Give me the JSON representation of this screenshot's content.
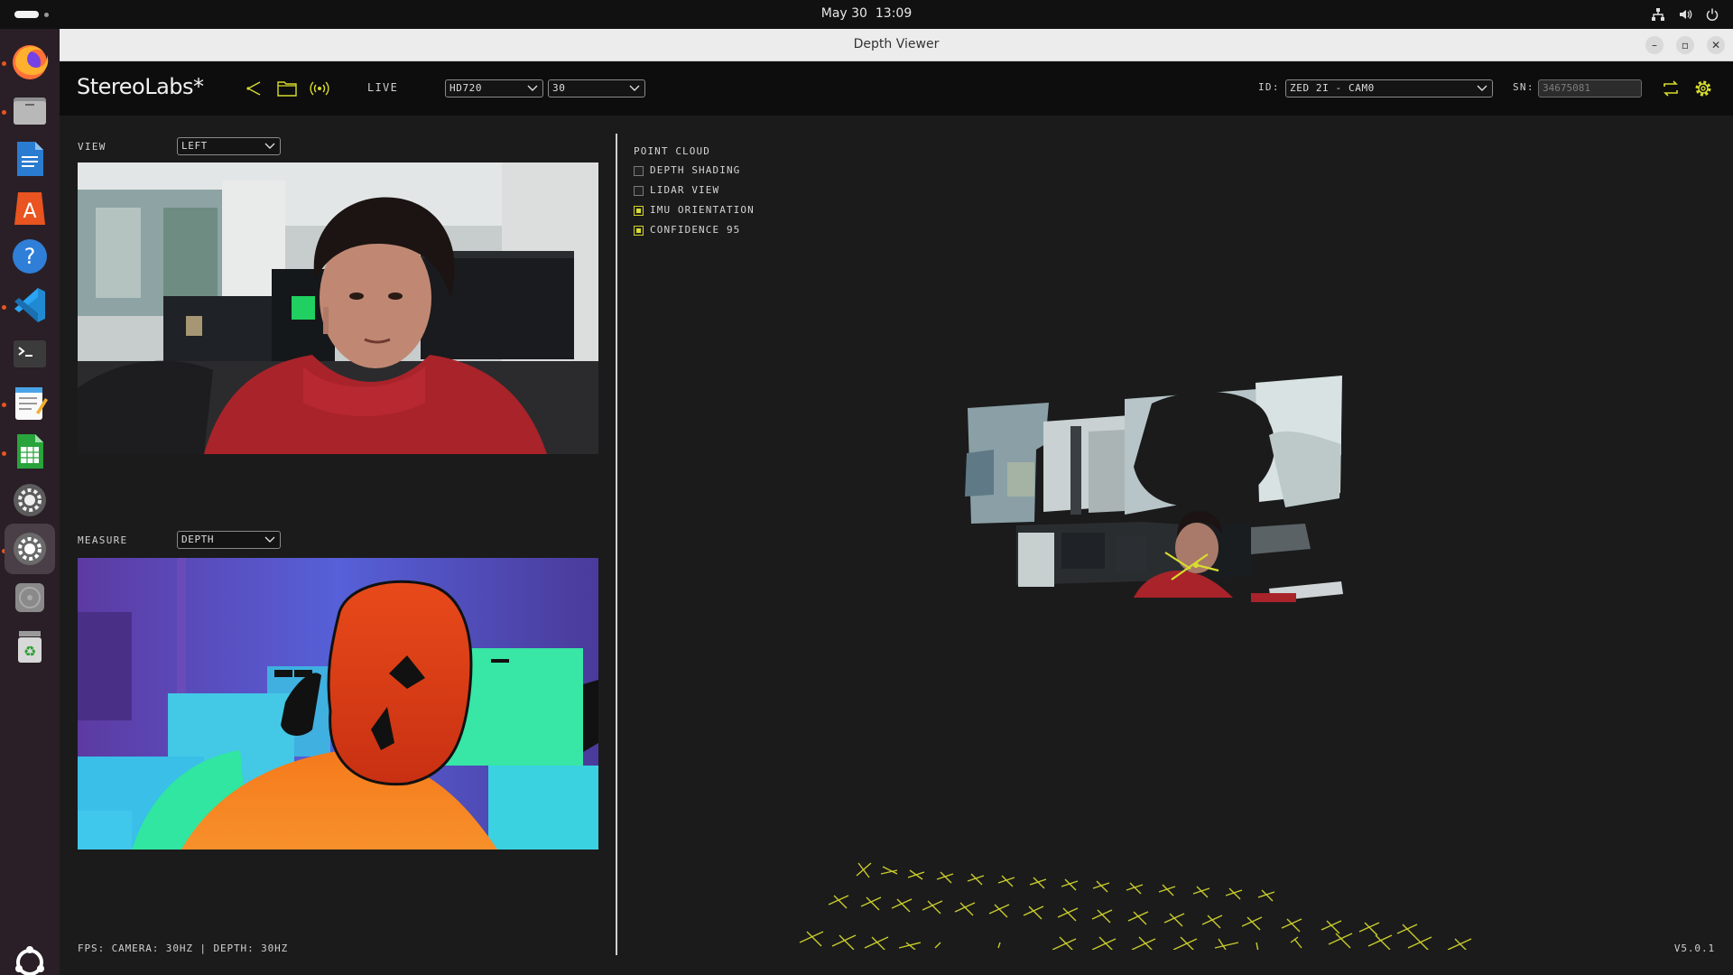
{
  "system": {
    "date": "May 30",
    "time": "13:09"
  },
  "window": {
    "title": "Depth Viewer"
  },
  "app": {
    "brand": "StereoLabs*",
    "live_label": "LIVE",
    "resolution": "HD720",
    "fps_option": "30",
    "id_label": "ID:",
    "camera_id": "ZED 2I - CAM0",
    "sn_label": "SN:",
    "serial_number": "34675081",
    "accent_color": "#d8dc2e"
  },
  "view_panel": {
    "label": "VIEW",
    "selected": "LEFT"
  },
  "measure_panel": {
    "label": "MEASURE",
    "selected": "DEPTH"
  },
  "point_cloud": {
    "title": "POINT CLOUD",
    "options": [
      {
        "label": "DEPTH SHADING",
        "checked": false
      },
      {
        "label": "LIDAR VIEW",
        "checked": false
      },
      {
        "label": "IMU ORIENTATION",
        "checked": true
      },
      {
        "label": "CONFIDENCE 95",
        "checked": true
      }
    ]
  },
  "footer": {
    "fps": "FPS: CAMERA: 30HZ | DEPTH: 30HZ",
    "version": "V5.0.1"
  },
  "dock": {
    "items": [
      "firefox-icon",
      "files-icon",
      "writer-icon",
      "app-center-icon",
      "help-icon",
      "vscode-icon",
      "terminal-icon",
      "text-editor-icon",
      "calc-icon",
      "settings-icon",
      "settings-active-icon",
      "disc-icon",
      "trash-icon",
      "show-apps-icon"
    ]
  }
}
